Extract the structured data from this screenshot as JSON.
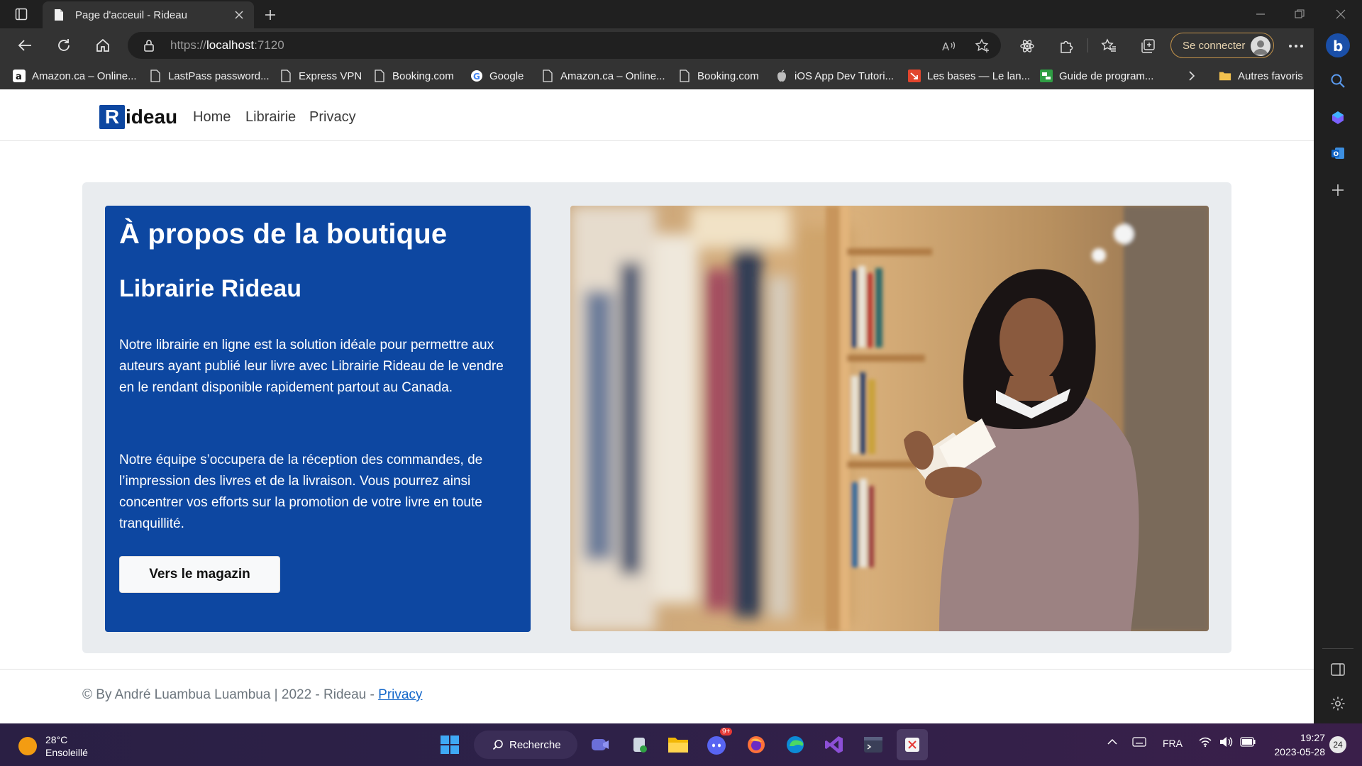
{
  "browser": {
    "tab_title": "Page d'acceuil - Rideau",
    "url_scheme": "https://",
    "url_host": "localhost",
    "url_port": ":7120",
    "signin_label": "Se connecter",
    "other_favorites": "Autres favoris",
    "bookmarks": [
      {
        "label": "Amazon.ca – Online...",
        "icon": "amazon-icon"
      },
      {
        "label": "LastPass password...",
        "icon": "page-icon"
      },
      {
        "label": "Express VPN",
        "icon": "page-icon"
      },
      {
        "label": "Booking.com",
        "icon": "page-icon"
      },
      {
        "label": "Google",
        "icon": "google-icon"
      },
      {
        "label": "Amazon.ca – Online...",
        "icon": "page-icon"
      },
      {
        "label": "Booking.com",
        "icon": "page-icon"
      },
      {
        "label": "iOS App Dev Tutori...",
        "icon": "apple-icon"
      },
      {
        "label": "Les bases — Le lan...",
        "icon": "arrow-bookmark-icon"
      },
      {
        "label": "Guide de program...",
        "icon": "green-app-icon"
      }
    ]
  },
  "site": {
    "brand_letter": "R",
    "brand_rest": "ideau",
    "nav": [
      "Home",
      "Librairie",
      "Privacy"
    ],
    "hero": {
      "title": "À propos de la boutique",
      "subtitle": "Librairie Rideau",
      "paragraph1": "Notre librairie en ligne est la solution idéale pour permettre aux auteurs ayant publié leur livre avec Librairie Rideau de le vendre en le rendant disponible rapidement partout au Canada.",
      "paragraph2": "Notre équipe s’occupera de la réception des commandes, de l’impression des livres et de la livraison. Vous pourrez ainsi concentrer vos efforts sur la promotion de votre livre en toute tranquillité.",
      "button_label": "Vers le magazin"
    },
    "footer": {
      "text": "© By André Luambua Luambua | 2022 - Rideau - ",
      "link": "Privacy"
    }
  },
  "taskbar": {
    "temperature": "28°C",
    "weather": "Ensoleillé",
    "search_label": "Recherche",
    "discord_badge": "9+",
    "language": "FRA",
    "time": "19:27",
    "date": "2023-05-28",
    "notifications": "24"
  },
  "colors": {
    "brand_blue": "#0d47a1",
    "hero_bg": "#e9ecef",
    "chrome_dark": "#202020",
    "chrome_mid": "#333333"
  }
}
